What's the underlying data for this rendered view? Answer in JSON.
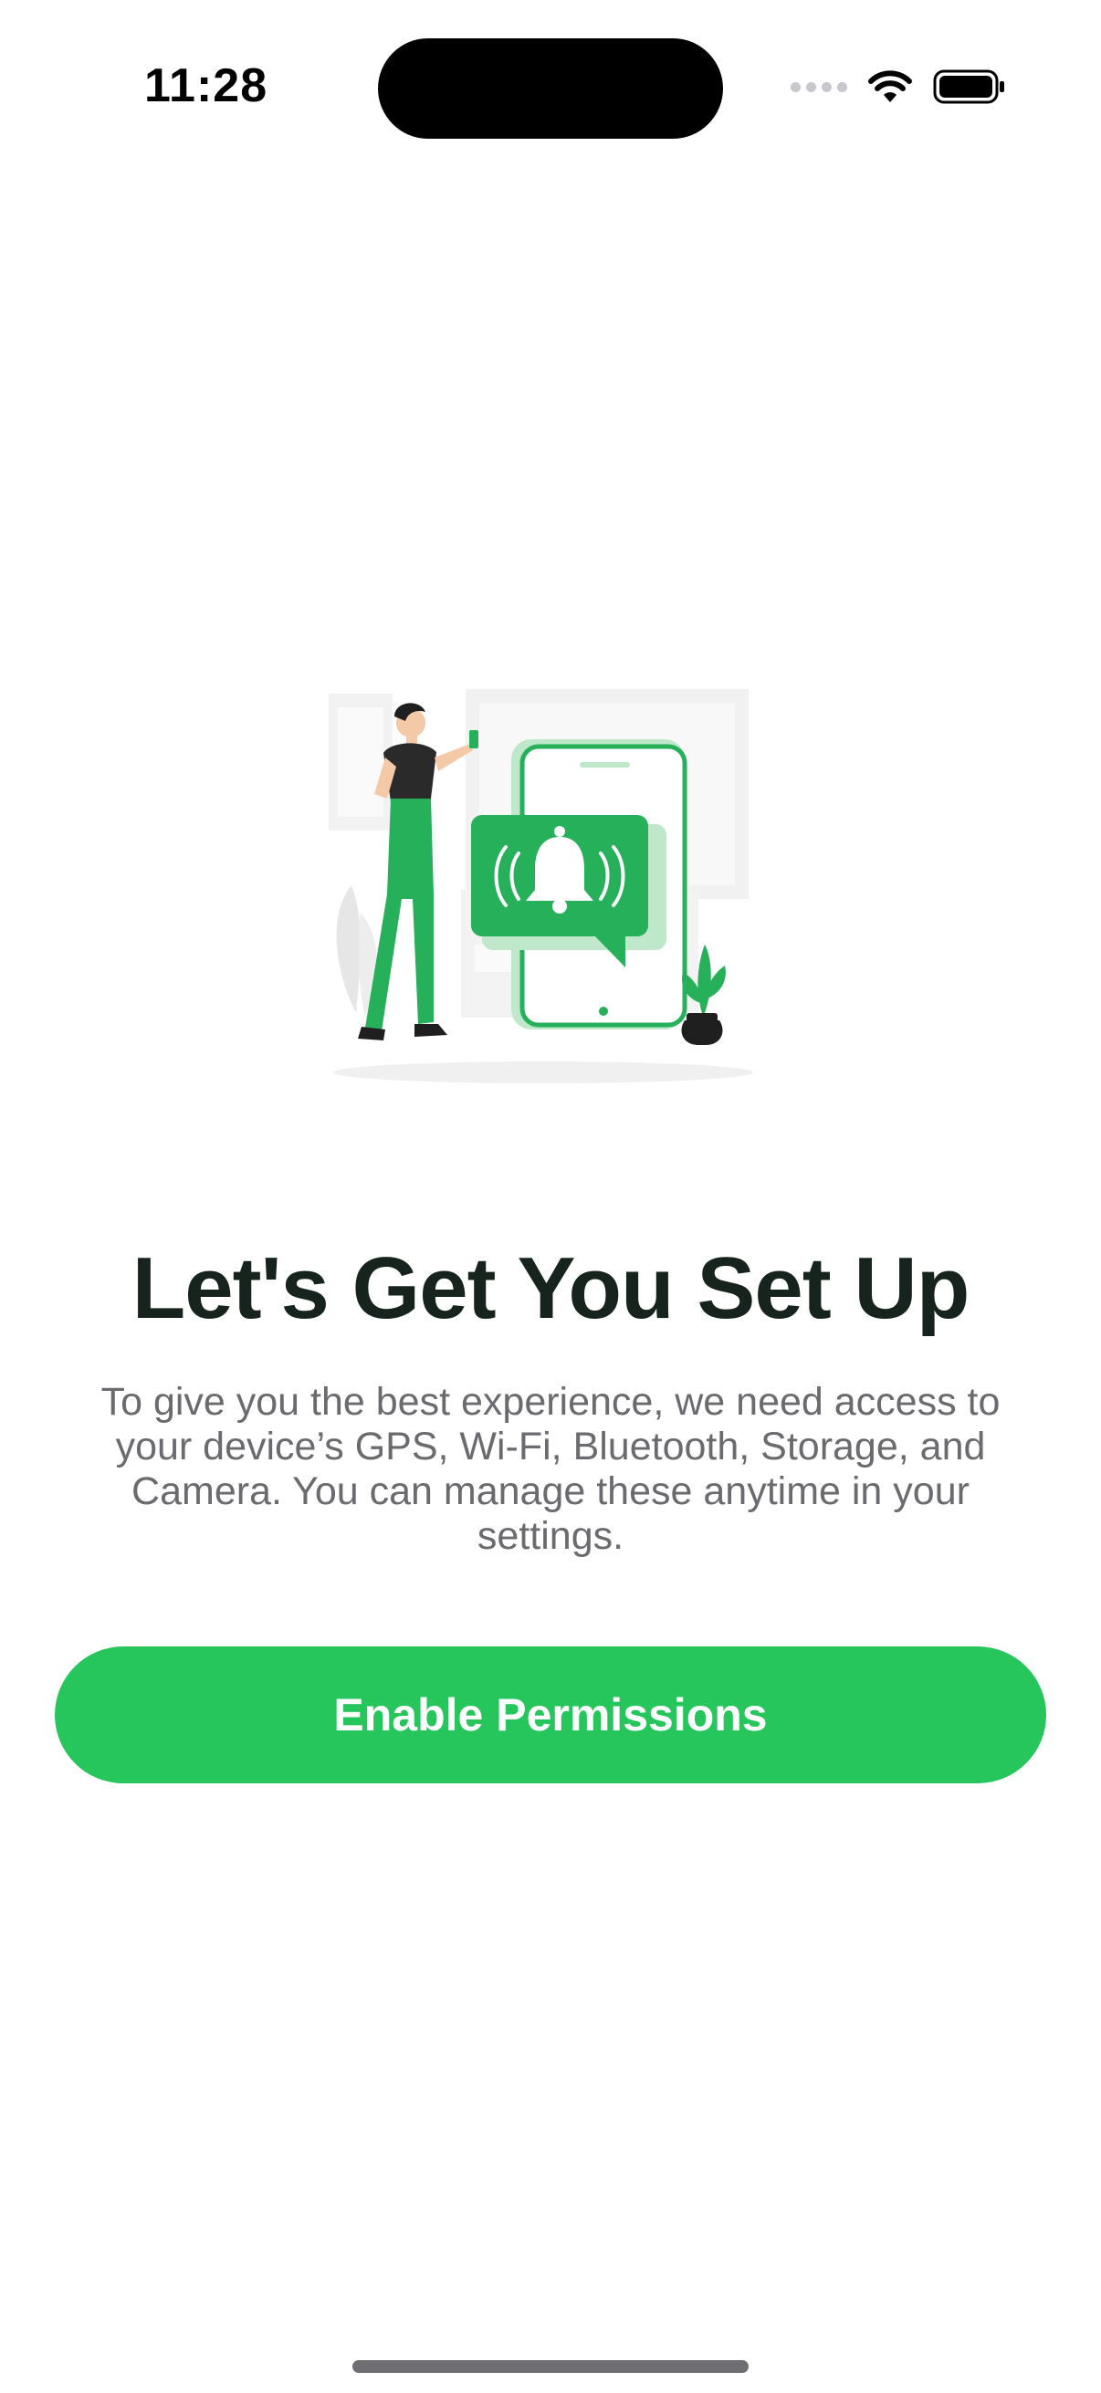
{
  "status_bar": {
    "time": "11:28",
    "icons": [
      "cellular-signal-icon",
      "wifi-icon",
      "battery-icon"
    ]
  },
  "illustration": {
    "icon": "notification-bell-icon",
    "colors": {
      "accent": "#26B05A",
      "accent_light": "#BFE8CB",
      "figure_dark": "#2A2A2A",
      "background_shapes": "#F0F0F0"
    }
  },
  "onboarding": {
    "title": "Let's Get You Set Up",
    "subtitle": "To give you the best experience, we need access to your device’s GPS, Wi-Fi, Bluetooth, Storage, and Camera. You can manage these anytime in your settings.",
    "primary_button_label": "Enable Permissions"
  },
  "theme": {
    "primary": "#26C65C",
    "title_color": "#17241D",
    "body_text": "#6A6A6F",
    "background": "#FFFFFF"
  }
}
